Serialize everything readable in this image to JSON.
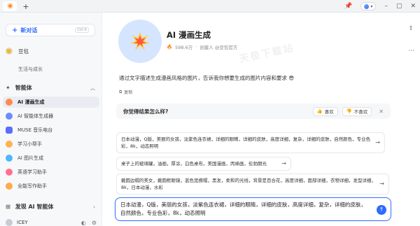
{
  "colors": {
    "accent": "#2f6bff",
    "sidebar_bg": "#f7f8fa",
    "active_bg": "#e9ecf2"
  },
  "sidebar": {
    "new_chat": {
      "label": "新对话",
      "shortcut": "Ctrl K"
    },
    "bot": {
      "name": "豆包",
      "sub": "生活与成长"
    },
    "agents_section": "智能体",
    "agents": [
      {
        "label": "AI 漫画生成",
        "color": "#ff8a4c"
      },
      {
        "label": "AI 智能体生成器",
        "color": "#6d8bff"
      },
      {
        "label": "MUSE 音乐电台",
        "color": "#5b6cff"
      },
      {
        "label": "学习小帮手",
        "color": "#ffb24c"
      },
      {
        "label": "AI 图片生成",
        "color": "#4cb7ff"
      },
      {
        "label": "英语学习助手",
        "color": "#ff6f91"
      },
      {
        "label": "全能写作助手",
        "color": "#ffa94c"
      }
    ],
    "discover": "发现 AI 智能体",
    "user": "ICEY"
  },
  "main": {
    "title": "AI 漫画生成",
    "stats": "598.6万",
    "creator": "创建人 @豆包官方",
    "watermark": "天极下载站",
    "intro": "通过文字描述生成漫画风格的图片，告诉我你想要生成的图片内容和要求 😎",
    "copy_label": "复制",
    "feedback": {
      "question": "你觉得结果怎么样?",
      "like": "喜欢",
      "dislike": "不喜欢"
    },
    "suggestions": [
      "日本动漫，Q版，美丽的女孩，淡紫色连衣裙，详细的眼睛，详细的皮肤，高度详细，复杂，详细的皮肤，自然颜色，专业色彩，8k，动态照明",
      "桌子上的玻璃罐，油画，厚涂，白色桌布，美国漫画，丙烯画，伦勃朗光",
      "戴圆边帽的美女，戴圆框眼镜，蓝色宽檐帽，黑发，柔和的光线，背景是百合花，高度详细，面部详细，衣物详细，发型详细，8k，日本动漫，水彩"
    ],
    "composer_text": "日本动漫，Q版，美丽的女孩，淡紫色连衣裙，详细的眼睛，详细的皮肤，高度详细，复杂，详细的皮肤，自然颜色，专业色彩，8k，动态照明"
  }
}
